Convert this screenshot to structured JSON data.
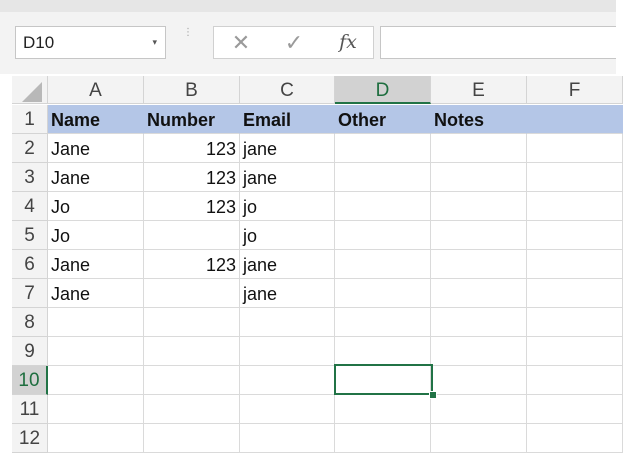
{
  "toolbar": {
    "name_box": "D10",
    "name_box_arrow": "▾",
    "grip": "⋮",
    "cancel_glyph": "✕",
    "enter_glyph": "✓",
    "function_glyph": "fx",
    "formula_value": ""
  },
  "columns": [
    "A",
    "B",
    "C",
    "D",
    "E",
    "F"
  ],
  "selected_column": "D",
  "rows": [
    "1",
    "2",
    "3",
    "4",
    "5",
    "6",
    "7",
    "8",
    "9",
    "10",
    "11",
    "12"
  ],
  "selected_row": "10",
  "header_fill_color": "#b4c6e7",
  "accent_color": "#217346",
  "sheet": {
    "header": [
      "Name",
      "Number",
      "Email",
      "Other",
      "Notes"
    ],
    "data": [
      [
        "Jane",
        "123",
        "jane"
      ],
      [
        "Jane",
        "123",
        "jane"
      ],
      [
        "Jo",
        "123",
        "jo"
      ],
      [
        "Jo",
        "",
        "jo"
      ],
      [
        "Jane",
        "123",
        "jane"
      ],
      [
        "Jane",
        "",
        "jane"
      ]
    ]
  }
}
